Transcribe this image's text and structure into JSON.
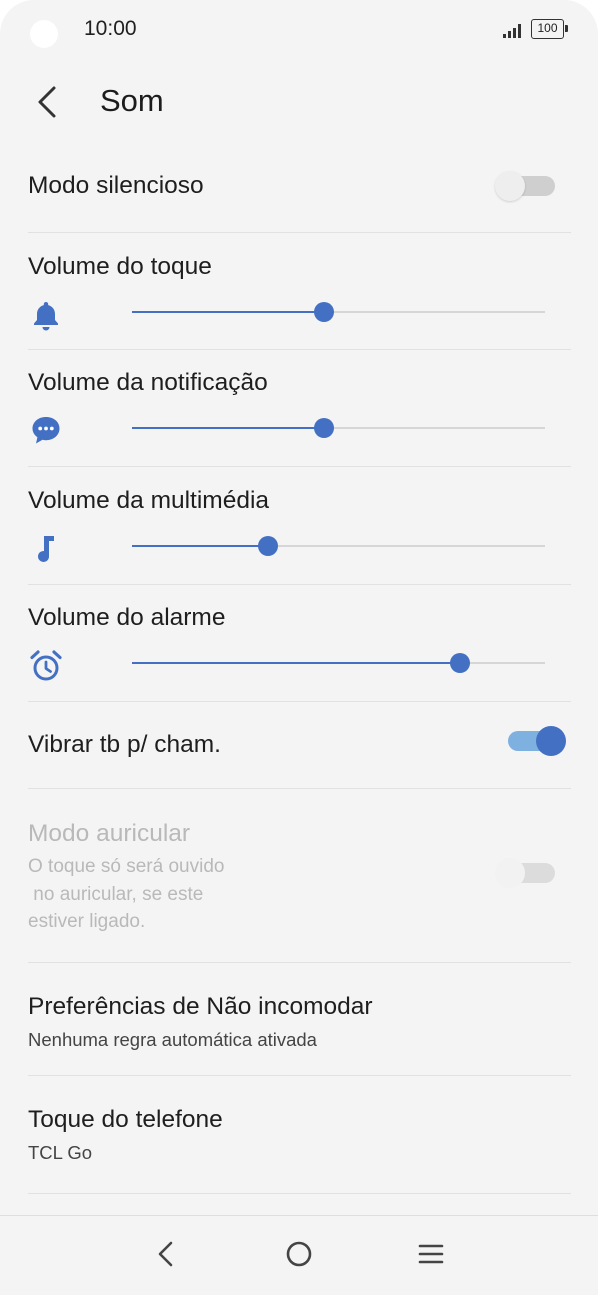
{
  "status_bar": {
    "time": "10:00",
    "battery": "100"
  },
  "header": {
    "title": "Som"
  },
  "settings": {
    "silent_mode": {
      "label": "Modo silencioso",
      "enabled": false
    },
    "ringtone_volume": {
      "label": "Volume do toque",
      "icon": "bell-icon",
      "level": 0.465
    },
    "notification_volume": {
      "label": "Volume da notificação",
      "icon": "chat-bubble-icon",
      "level": 0.465
    },
    "media_volume": {
      "label": "Volume da multimédia",
      "icon": "music-note-icon",
      "level": 0.33
    },
    "alarm_volume": {
      "label": "Volume do alarme",
      "icon": "alarm-clock-icon",
      "level": 0.795
    },
    "vibrate_calls": {
      "label": "Vibrar tb p/ cham.",
      "enabled": true
    },
    "earpiece_mode": {
      "label": "Modo auricular",
      "description_lines": [
        "O toque só será ouvido",
        " no auricular, se este",
        "estiver ligado."
      ],
      "enabled": false,
      "disabled": true
    },
    "dnd_preferences": {
      "label": "Preferências de Não incomodar",
      "summary": "Nenhuma regra automática ativada"
    },
    "phone_ringtone": {
      "label": "Toque do telefone",
      "summary": "TCL Go"
    }
  },
  "colors": {
    "accent": "#4470C4",
    "accent_light": "#7EB1DF",
    "background": "#F4F4F4",
    "divider": "#E1E1E1",
    "disabled_text": "#B9B9B9"
  },
  "nav_bar": {
    "back": "back-icon",
    "home": "home-icon",
    "menu": "menu-icon"
  }
}
